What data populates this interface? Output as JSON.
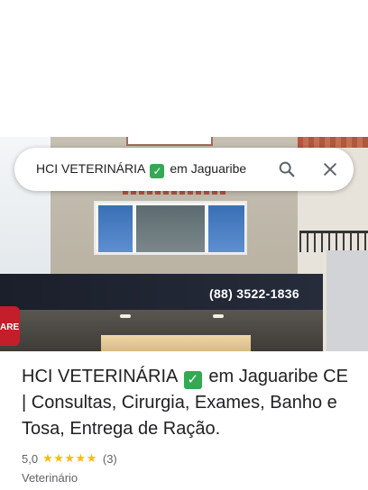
{
  "search": {
    "query_before": "HCI VETERINÁRIA",
    "query_after": "em Jaguaribe"
  },
  "photo": {
    "storefront_phone": "(88) 3522-1836",
    "street_sign_partial": "ARE"
  },
  "place": {
    "title_before": "HCI VETERINÁRIA",
    "title_after": "em Jaguaribe CE | Consultas, Cirurgia, Exames, Banho e Tosa, Entrega de Ração.",
    "rating": "5,0",
    "stars": "★★★★★",
    "review_count": "(3)",
    "category": "Veterinário"
  },
  "icons": {
    "check": "✓",
    "search": "search-icon",
    "close": "close-icon"
  },
  "colors": {
    "star": "#fbbc04",
    "check_green": "#34a853",
    "text_primary": "#202124",
    "text_secondary": "#5f6368"
  }
}
